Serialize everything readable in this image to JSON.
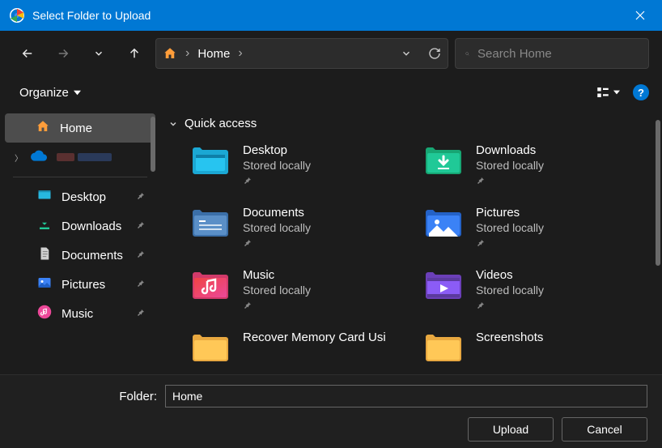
{
  "window": {
    "title": "Select Folder to Upload"
  },
  "breadcrumb": {
    "current": "Home"
  },
  "search": {
    "placeholder": "Search Home"
  },
  "toolbar": {
    "organize": "Organize"
  },
  "sidebar": {
    "items": [
      {
        "label": "Home",
        "icon": "home",
        "active": true
      },
      {
        "label": "OneDrive",
        "icon": "cloud",
        "expandable": true,
        "redacted": true
      },
      {
        "divider": true
      },
      {
        "label": "Desktop",
        "icon": "desktop",
        "pinned": true
      },
      {
        "label": "Downloads",
        "icon": "downloads",
        "pinned": true
      },
      {
        "label": "Documents",
        "icon": "documents",
        "pinned": true
      },
      {
        "label": "Pictures",
        "icon": "pictures",
        "pinned": true
      },
      {
        "label": "Music",
        "icon": "music",
        "pinned": true
      }
    ]
  },
  "section": {
    "title": "Quick access"
  },
  "items": [
    {
      "name": "Desktop",
      "sub": "Stored locally",
      "pinned": true,
      "icon": "desktop"
    },
    {
      "name": "Downloads",
      "sub": "Stored locally",
      "pinned": true,
      "icon": "downloads"
    },
    {
      "name": "Documents",
      "sub": "Stored locally",
      "pinned": true,
      "icon": "documents"
    },
    {
      "name": "Pictures",
      "sub": "Stored locally",
      "pinned": true,
      "icon": "pictures"
    },
    {
      "name": "Music",
      "sub": "Stored locally",
      "pinned": true,
      "icon": "music"
    },
    {
      "name": "Videos",
      "sub": "Stored locally",
      "pinned": true,
      "icon": "videos"
    },
    {
      "name": "Recover Memory Card Usi",
      "sub": "",
      "pinned": false,
      "icon": "folder"
    },
    {
      "name": "Screenshots",
      "sub": "",
      "pinned": false,
      "icon": "folder"
    }
  ],
  "footer": {
    "folder_label": "Folder:",
    "folder_value": "Home",
    "upload": "Upload",
    "cancel": "Cancel"
  }
}
